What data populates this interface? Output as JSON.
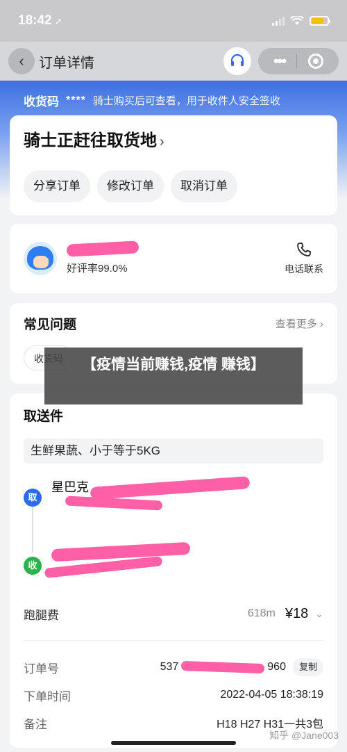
{
  "status_bar": {
    "time": "18:42"
  },
  "nav": {
    "title": "订单详情"
  },
  "pickup_code": {
    "label": "收货码",
    "masked": "****",
    "tip": "骑士购买后可查看，用于收件人安全签收"
  },
  "status_card": {
    "title": "骑士正赶往取货地",
    "buttons": [
      "分享订单",
      "修改订单",
      "取消订单"
    ]
  },
  "rider": {
    "rating": "好评率99.0%",
    "call_label": "电话联系"
  },
  "faq": {
    "title": "常见问题",
    "more": "查看更多",
    "chip": "收货码"
  },
  "overlay_banner": {
    "text": "【疫情当前赚钱,疫情 赚钱】"
  },
  "order": {
    "title": "取送件",
    "goods": "生鲜果蔬、小于等于5KG",
    "pickup_tag": "取",
    "pickup_name": "星巴克",
    "receive_tag": "收",
    "fee_label": "跑腿费",
    "distance": "618m",
    "price": "¥18",
    "order_no_label": "订单号",
    "order_no_value": "537",
    "order_no_tail": "960",
    "copy_label": "复制",
    "time_label": "下单时间",
    "time_value": "2022-04-05 18:38:19",
    "note_label": "备注",
    "note_value": "H18 H27 H31一共3包"
  },
  "watermark": "知乎 @Jane003",
  "colors": {
    "accent_blue": "#2f6be8",
    "pick_tag": "#2f6be8",
    "receive_tag": "#2bb34b",
    "redaction": "#ff5fa6"
  }
}
